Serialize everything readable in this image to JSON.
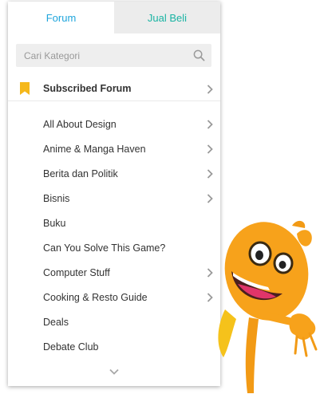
{
  "tabs": [
    {
      "label": "Forum",
      "active": true
    },
    {
      "label": "Jual Beli",
      "active": false
    }
  ],
  "search": {
    "placeholder": "Cari Kategori",
    "icon": "search-icon"
  },
  "subscribed": {
    "label": "Subscribed Forum",
    "icon": "bookmark-icon",
    "has_submenu": true
  },
  "categories": [
    {
      "label": "All About Design",
      "has_submenu": true
    },
    {
      "label": "Anime & Manga Haven",
      "has_submenu": true
    },
    {
      "label": "Berita dan Politik",
      "has_submenu": true
    },
    {
      "label": "Bisnis",
      "has_submenu": true
    },
    {
      "label": "Buku",
      "has_submenu": false
    },
    {
      "label": "Can You Solve This Game?",
      "has_submenu": false
    },
    {
      "label": "Computer Stuff",
      "has_submenu": true
    },
    {
      "label": "Cooking & Resto Guide",
      "has_submenu": true
    },
    {
      "label": "Deals",
      "has_submenu": false
    },
    {
      "label": "Debate Club",
      "has_submenu": false
    }
  ],
  "colors": {
    "tab_active_text": "#1ea5dc",
    "tab_inactive_text": "#1ab4a3",
    "tab_inactive_bg": "#ececec",
    "bookmark": "#f5b81b",
    "mascot_body": "#f7a21b"
  },
  "footer": {
    "more_icon": "chevron-down-icon"
  }
}
